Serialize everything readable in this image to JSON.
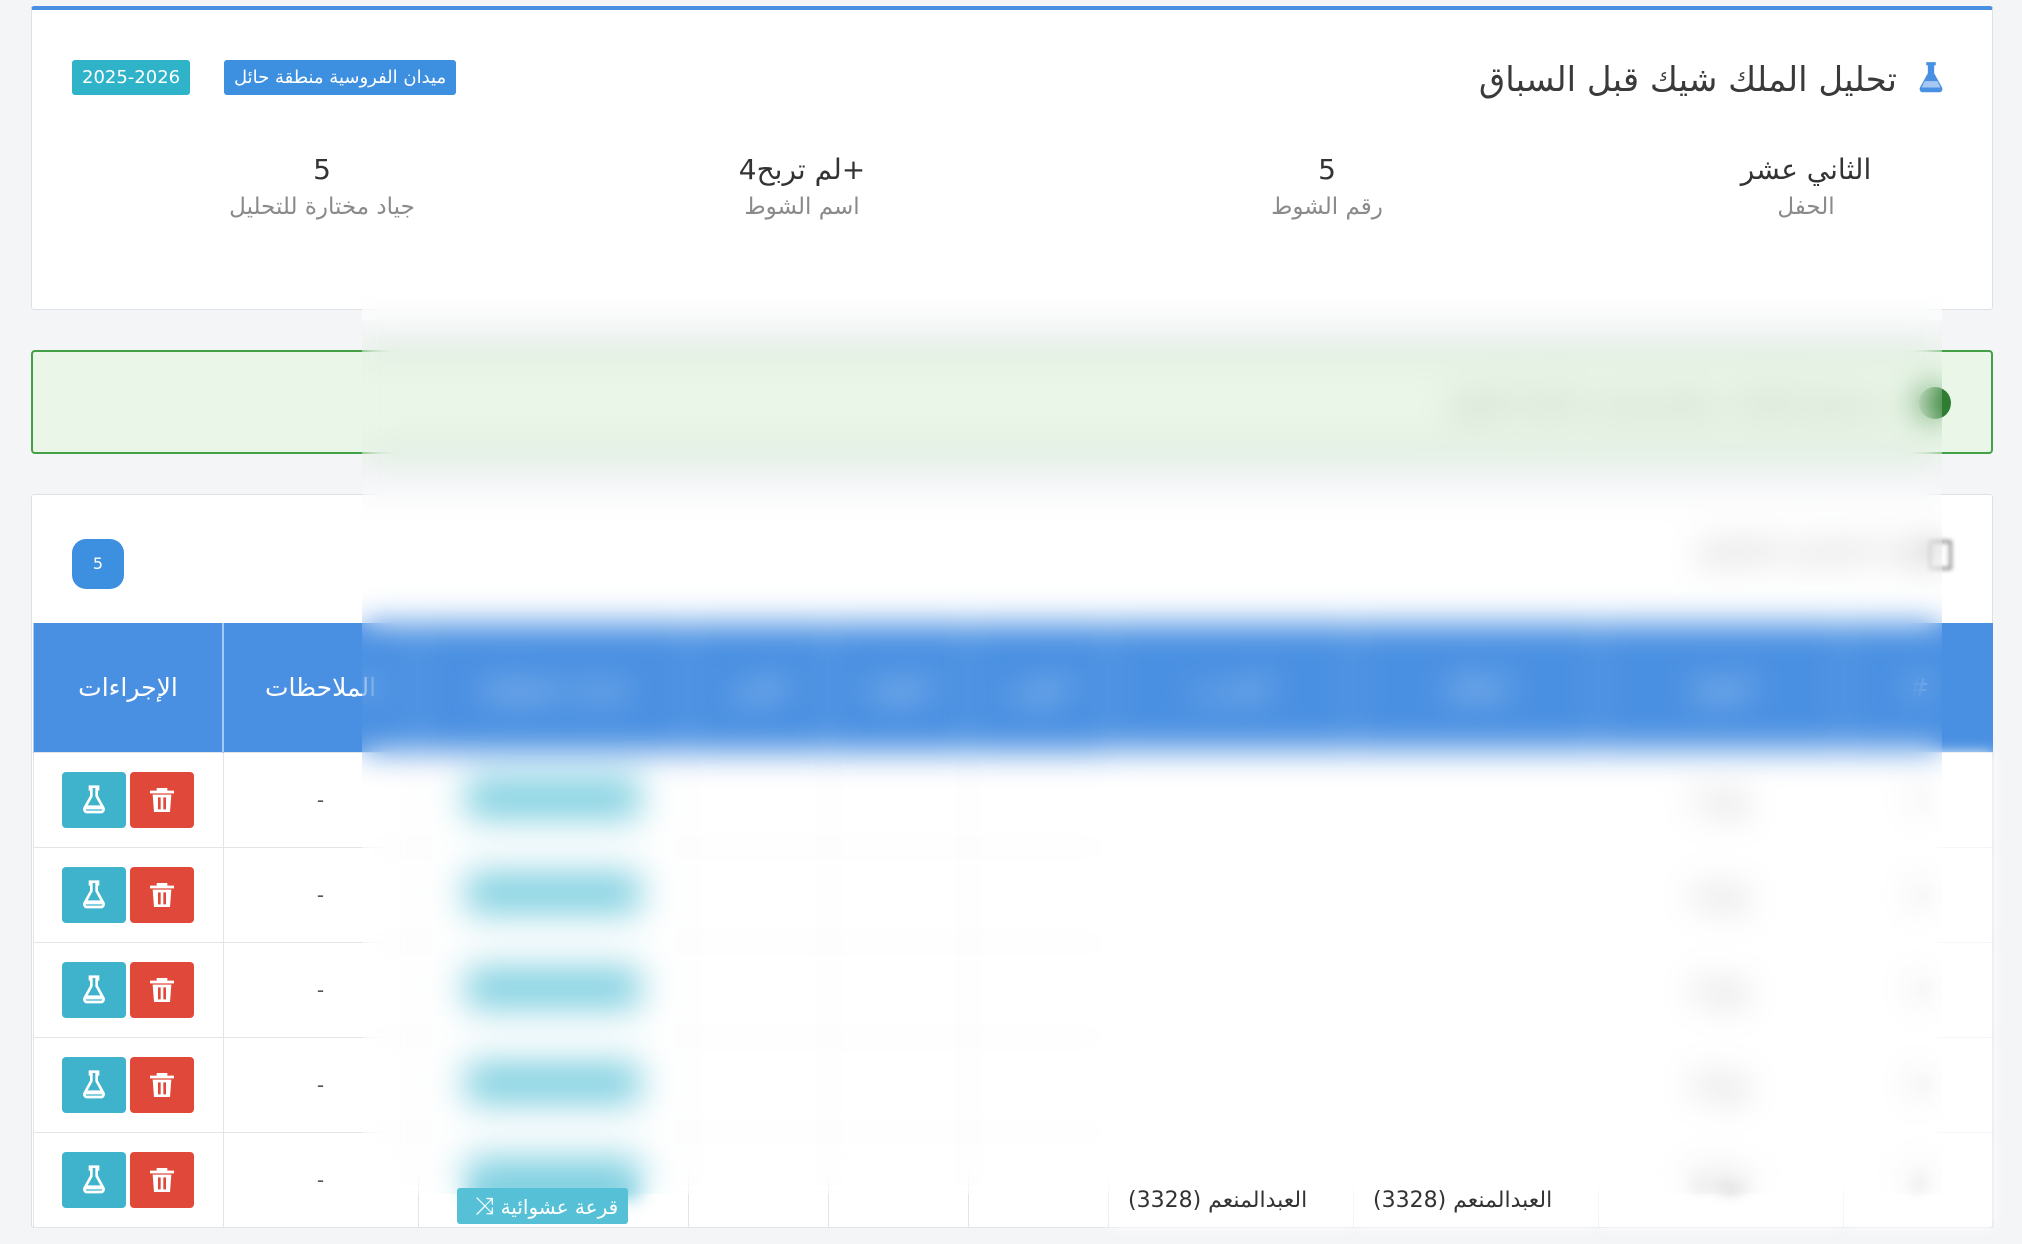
{
  "header": {
    "title": "تحليل الملك شيك قبل السباق",
    "venue_badge": "ميدان الفروسية منطقة حائل",
    "season_badge": "2025-2026",
    "stats": [
      {
        "value": "الثاني عشر",
        "label": "الحفل"
      },
      {
        "value": "5",
        "label": "رقم الشوط"
      },
      {
        "value": "لم تربح4+",
        "label": "اسم الشوط"
      },
      {
        "value": "5",
        "label": "جياد مختارة للتحليل"
      }
    ]
  },
  "alert": {
    "text": "تم تحميل البيانات بنجاح وتحديث قائمة الخيول"
  },
  "section": {
    "title": "الجياد المختارة للتحليل",
    "count": "5"
  },
  "table": {
    "headers": [
      "#",
      "الجواد",
      "المالك",
      "المدرب",
      "الوزن",
      "البوابة",
      "العمر",
      "قرعة عشوائية",
      "الملاحظات",
      "الإجراءات"
    ],
    "rows": [
      {
        "num": "1",
        "horse": "جواد 1",
        "owner": "",
        "trainer": "",
        "notes": "-"
      },
      {
        "num": "2",
        "horse": "جواد 2",
        "owner": "",
        "trainer": "",
        "notes": "-"
      },
      {
        "num": "3",
        "horse": "جواد 3",
        "owner": "",
        "trainer": "",
        "notes": "-"
      },
      {
        "num": "4",
        "horse": "جواد 4",
        "owner": "",
        "trainer": "",
        "notes": "-"
      },
      {
        "num": "5",
        "horse": "جواد 5",
        "owner": "",
        "trainer": "",
        "notes": "-"
      }
    ],
    "random_draw_label": "قرعة عشوائية",
    "visible_owner": "العبدالمنعم (3328)",
    "visible_trainer": "العبدالمنعم (3328)"
  },
  "colors": {
    "primary": "#4a90e2",
    "danger": "#e0493a",
    "info": "#3fb2cc",
    "success": "#43a047"
  }
}
